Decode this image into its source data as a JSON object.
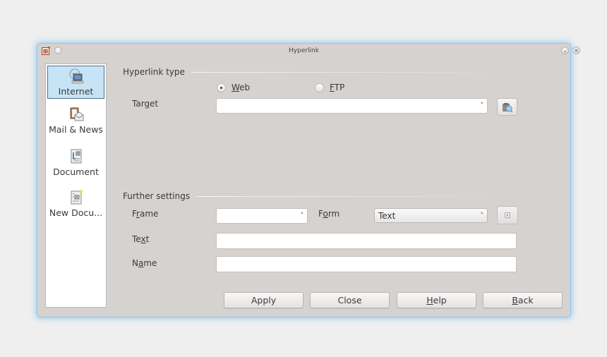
{
  "window": {
    "title": "Hyperlink",
    "app_icon": "impress-document-icon",
    "buttons": {
      "menu": "window-menu-icon",
      "minimize": "minimize-icon",
      "close": "close-icon"
    }
  },
  "sidebar": {
    "items": [
      {
        "label": "Internet",
        "icon": "internet-globe-computer-icon",
        "selected": true
      },
      {
        "label": "Mail & News",
        "icon": "mail-news-icon",
        "selected": false
      },
      {
        "label": "Document",
        "icon": "document-icon",
        "selected": false
      },
      {
        "label": "New Docu...",
        "icon": "new-document-icon",
        "selected": false
      }
    ]
  },
  "hyperlink_type": {
    "heading": "Hyperlink type",
    "options": [
      {
        "label": "Web",
        "mnemonic": "W",
        "rest": "eb",
        "checked": true
      },
      {
        "label": "FTP",
        "mnemonic": "F",
        "rest": "TP",
        "checked": false
      }
    ],
    "target": {
      "label_pre": "Tar",
      "mnemonic": "g",
      "label_post": "et",
      "value": ""
    },
    "browse_button": "open-file-browser-icon"
  },
  "further_settings": {
    "heading": "Further settings",
    "frame": {
      "label_pre": "F",
      "mnemonic": "r",
      "label_post": "ame",
      "value": ""
    },
    "form": {
      "label_pre": "F",
      "mnemonic": "o",
      "label_post": "rm",
      "value": "Text"
    },
    "events_button": "events-icon",
    "text": {
      "label_pre": "Te",
      "mnemonic": "x",
      "label_post": "t",
      "value": ""
    },
    "name": {
      "label_pre": "N",
      "mnemonic": "a",
      "label_post": "me",
      "value": ""
    }
  },
  "buttons": {
    "apply": "Apply",
    "close": "Close",
    "help": {
      "mnemonic": "H",
      "rest": "elp"
    },
    "back": {
      "mnemonic": "B",
      "rest": "ack"
    }
  }
}
